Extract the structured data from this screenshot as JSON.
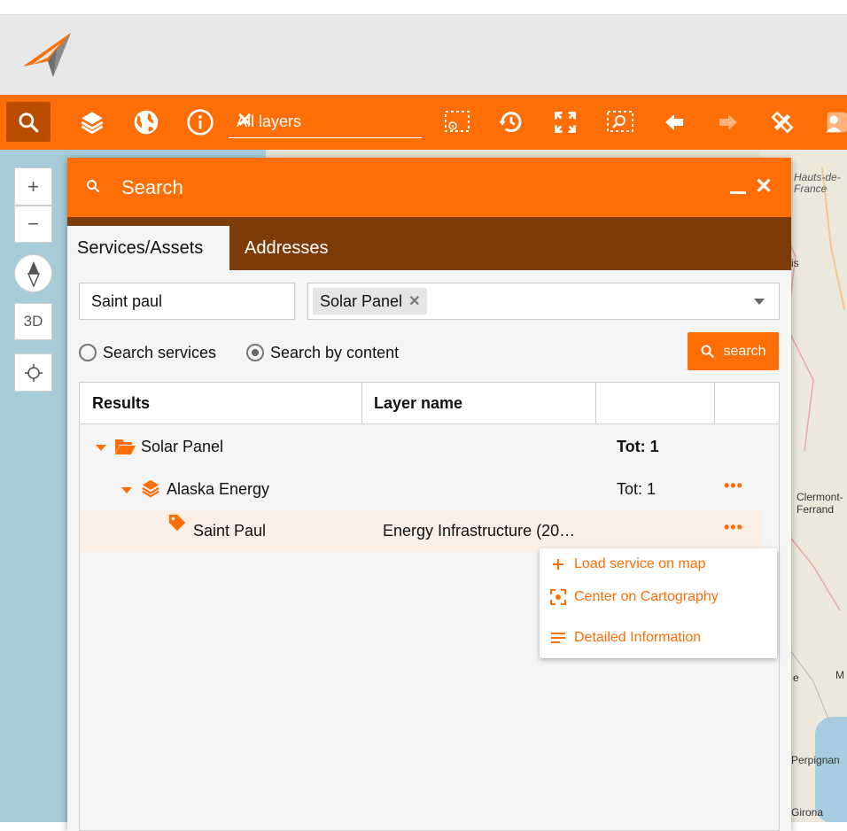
{
  "toolbar": {
    "layer_filter_value": "All layers",
    "clear_label": "✕"
  },
  "map_controls": {
    "zoom_in": "+",
    "zoom_out": "−",
    "view_3d": "3D"
  },
  "map_labels": {
    "top_right": "Hauts-de-France",
    "is_fragment": "is",
    "clermont": "Clermont-Ferrand",
    "e_fragment": "e",
    "m_fragment": "M",
    "perpignan": "Perpignan",
    "girona": "Girona"
  },
  "search_panel": {
    "title": "Search",
    "tabs": [
      "Services/Assets",
      "Addresses"
    ],
    "query_value": "Saint paul",
    "selected_layer_chip": "Solar Panel",
    "radio_options": [
      "Search services",
      "Search by content"
    ],
    "selected_radio": "Search by content",
    "search_button_label": "search",
    "table": {
      "headers": [
        "Results",
        "Layer name",
        "",
        ""
      ],
      "rows": [
        {
          "level": 0,
          "label": "Solar Panel",
          "layer": "",
          "total": "Tot: 1"
        },
        {
          "level": 1,
          "label": "Alaska Energy",
          "layer": "",
          "total": "Tot: 1"
        },
        {
          "level": 2,
          "label": "Saint Paul",
          "layer": "Energy Infrastructure (20…",
          "total": ""
        }
      ]
    },
    "context_menu": [
      {
        "icon": "plus-icon",
        "label": "Load service on map"
      },
      {
        "icon": "center-focus-icon",
        "label": "Center on Cartography"
      },
      {
        "icon": "list-lines-icon",
        "label": "Detailed Information"
      }
    ]
  },
  "colors": {
    "accent": "#ff6d05",
    "tab_bar": "#7e3b0a",
    "selected_row": "#fbefe5"
  }
}
